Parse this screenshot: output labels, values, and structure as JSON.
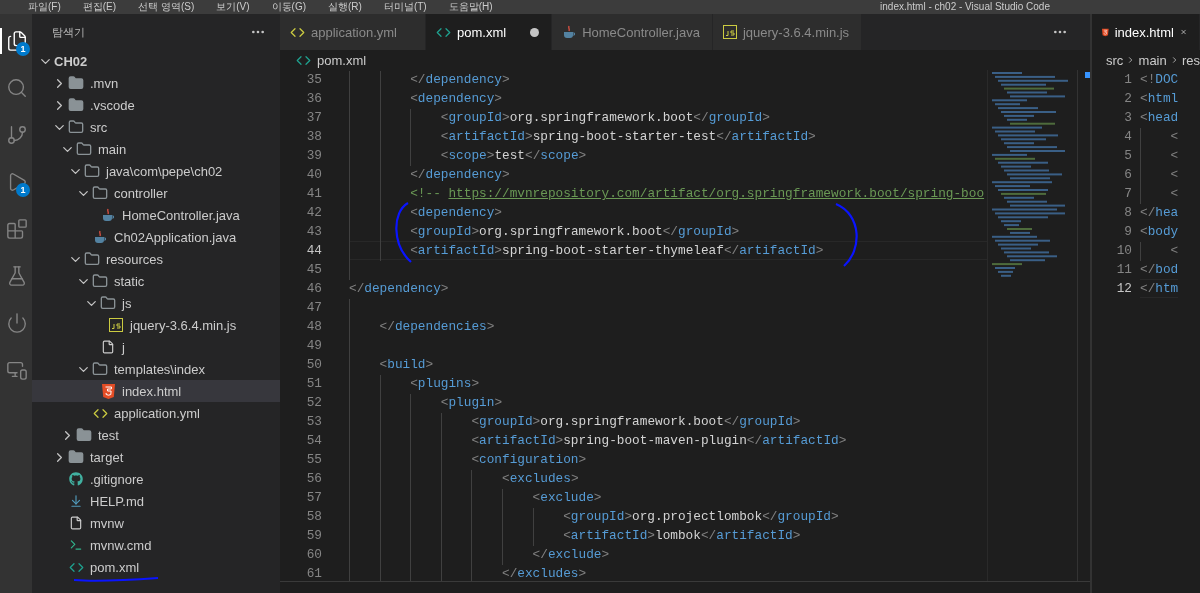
{
  "title_bar": {
    "menu": [
      "파일(F)",
      "편집(E)",
      "선택 영역(S)",
      "보기(V)",
      "이동(G)",
      "실행(R)",
      "터미널(T)",
      "도움말(H)"
    ],
    "title": "index.html - ch02 - Visual Studio Code"
  },
  "activity_bar": [
    {
      "kind": "files",
      "selected": true,
      "badge": "1"
    },
    {
      "kind": "search",
      "selected": false
    },
    {
      "kind": "branch",
      "selected": false
    },
    {
      "kind": "debug",
      "selected": false,
      "badge": "1"
    },
    {
      "kind": "extensions",
      "selected": false
    },
    {
      "kind": "testing",
      "selected": false
    },
    {
      "kind": "power",
      "selected": false
    },
    {
      "kind": "remote",
      "selected": false
    }
  ],
  "explorer": {
    "title": "탐색기",
    "root": {
      "label": "CH02",
      "kind": "folder",
      "expanded": true,
      "selected": false,
      "children": [
        {
          "label": ".mvn",
          "kind": "folder",
          "expanded": false,
          "selected": false
        },
        {
          "label": ".vscode",
          "kind": "folder",
          "expanded": false,
          "selected": false
        },
        {
          "label": "src",
          "kind": "folder",
          "expanded": true,
          "selected": false,
          "children": [
            {
              "label": "main",
              "kind": "folder",
              "expanded": true,
              "selected": false,
              "children": [
                {
                  "label": "java\\com\\pepe\\ch02",
                  "kind": "folder",
                  "expanded": true,
                  "selected": false,
                  "children": [
                    {
                      "label": "controller",
                      "kind": "folder",
                      "expanded": true,
                      "selected": false,
                      "children": [
                        {
                          "label": "HomeController.java",
                          "kind": "java",
                          "selected": false
                        }
                      ]
                    },
                    {
                      "label": "Ch02Application.java",
                      "kind": "java",
                      "selected": false
                    }
                  ]
                },
                {
                  "label": "resources",
                  "kind": "folder",
                  "expanded": true,
                  "selected": false,
                  "children": [
                    {
                      "label": "static",
                      "kind": "folder",
                      "expanded": true,
                      "selected": false,
                      "children": [
                        {
                          "label": "js",
                          "kind": "folder",
                          "expanded": true,
                          "selected": false,
                          "children": [
                            {
                              "label": "jquery-3.6.4.min.js",
                              "kind": "js",
                              "selected": false
                            }
                          ]
                        },
                        {
                          "label": "j",
                          "kind": "file",
                          "selected": false
                        }
                      ]
                    },
                    {
                      "label": "templates\\index",
                      "kind": "folder",
                      "expanded": true,
                      "selected": false,
                      "children": [
                        {
                          "label": "index.html",
                          "kind": "html",
                          "selected": true
                        }
                      ]
                    },
                    {
                      "label": "application.yml",
                      "kind": "yaml",
                      "selected": false
                    }
                  ]
                }
              ]
            },
            {
              "label": "test",
              "kind": "folder",
              "expanded": false,
              "selected": false
            }
          ]
        },
        {
          "label": "target",
          "kind": "folder",
          "expanded": false,
          "selected": false
        },
        {
          "label": ".gitignore",
          "kind": "git",
          "selected": false
        },
        {
          "label": "HELP.md",
          "kind": "markdown",
          "selected": false
        },
        {
          "label": "mvnw",
          "kind": "file",
          "selected": false
        },
        {
          "label": "mvnw.cmd",
          "kind": "terminal",
          "selected": false
        },
        {
          "label": "pom.xml",
          "kind": "xml",
          "selected": false
        }
      ]
    }
  },
  "editor": {
    "tabs": [
      {
        "label": "application.yml",
        "kind": "yaml",
        "selected": false,
        "modified": false
      },
      {
        "label": "pom.xml",
        "kind": "xml",
        "selected": true,
        "modified": true
      },
      {
        "label": "HomeController.java",
        "kind": "java",
        "selected": false,
        "modified": false
      },
      {
        "label": "jquery-3.6.4.min.js",
        "kind": "js",
        "selected": false,
        "modified": false
      }
    ],
    "breadcrumb": {
      "kind": "xml",
      "label": "pom.xml"
    },
    "lines": [
      {
        "number": "35",
        "code": "        </dependency>",
        "current": false
      },
      {
        "number": "36",
        "code": "        <dependency>",
        "current": false
      },
      {
        "number": "37",
        "code": "            <groupId>org.springframework.boot</groupId>",
        "current": false
      },
      {
        "number": "38",
        "code": "            <artifactId>spring-boot-starter-test</artifactId>",
        "current": false
      },
      {
        "number": "39",
        "code": "            <scope>test</scope>",
        "current": false
      },
      {
        "number": "40",
        "code": "        </dependency>",
        "current": false
      },
      {
        "number": "41",
        "code": "        <!-- ",
        "link": "https://mvnrepository.com/artifact/org.springframework.boot/spring-boo",
        "current": false
      },
      {
        "number": "42",
        "code": "        <dependency>",
        "current": false
      },
      {
        "number": "43",
        "code": "        <groupId>org.springframework.boot</groupId>",
        "current": false
      },
      {
        "number": "44",
        "code": "        <artifactId>spring-boot-starter-thymeleaf</artifactId>",
        "current": true
      },
      {
        "number": "45",
        "current": false
      },
      {
        "number": "46",
        "code": "</dependency>",
        "current": false
      },
      {
        "number": "47",
        "current": false
      },
      {
        "number": "48",
        "code": "    </dependencies>",
        "current": false
      },
      {
        "number": "49",
        "current": false
      },
      {
        "number": "50",
        "code": "    <build>",
        "current": false
      },
      {
        "number": "51",
        "code": "        <plugins>",
        "current": false
      },
      {
        "number": "52",
        "code": "            <plugin>",
        "current": false
      },
      {
        "number": "53",
        "code": "                <groupId>org.springframework.boot</groupId>",
        "current": false
      },
      {
        "number": "54",
        "code": "                <artifactId>spring-boot-maven-plugin</artifactId>",
        "current": false
      },
      {
        "number": "55",
        "code": "                <configuration>",
        "current": false
      },
      {
        "number": "56",
        "code": "                    <excludes>",
        "current": false
      },
      {
        "number": "57",
        "code": "                        <exclude>",
        "current": false
      },
      {
        "number": "58",
        "code": "                            <groupId>org.projectlombok</groupId>",
        "current": false
      },
      {
        "number": "59",
        "code": "                            <artifactId>lombok</artifactId>",
        "current": false
      },
      {
        "number": "60",
        "code": "                        </exclude>",
        "current": false
      },
      {
        "number": "61",
        "code": "                    </excludes>",
        "current": false
      }
    ]
  },
  "side_editor": {
    "tab": {
      "label": "index.html",
      "kind": "html",
      "selected": true
    },
    "breadcrumb": [
      "src",
      "main",
      "res"
    ],
    "lines": [
      {
        "number": "1",
        "code": "<!DOC",
        "current": false
      },
      {
        "number": "2",
        "code": "<html",
        "current": false
      },
      {
        "number": "3",
        "code": "<head",
        "current": false
      },
      {
        "number": "4",
        "code": "    <",
        "current": false
      },
      {
        "number": "5",
        "code": "    <",
        "current": false
      },
      {
        "number": "6",
        "code": "    <",
        "current": false
      },
      {
        "number": "7",
        "code": "    <",
        "current": false
      },
      {
        "number": "8",
        "code": "</hea",
        "current": false
      },
      {
        "number": "9",
        "code": "<body",
        "current": false
      },
      {
        "number": "10",
        "code": "    <",
        "current": false
      },
      {
        "number": "11",
        "code": "</bod",
        "current": false
      },
      {
        "number": "12",
        "code": "</htm",
        "current": true
      }
    ]
  }
}
